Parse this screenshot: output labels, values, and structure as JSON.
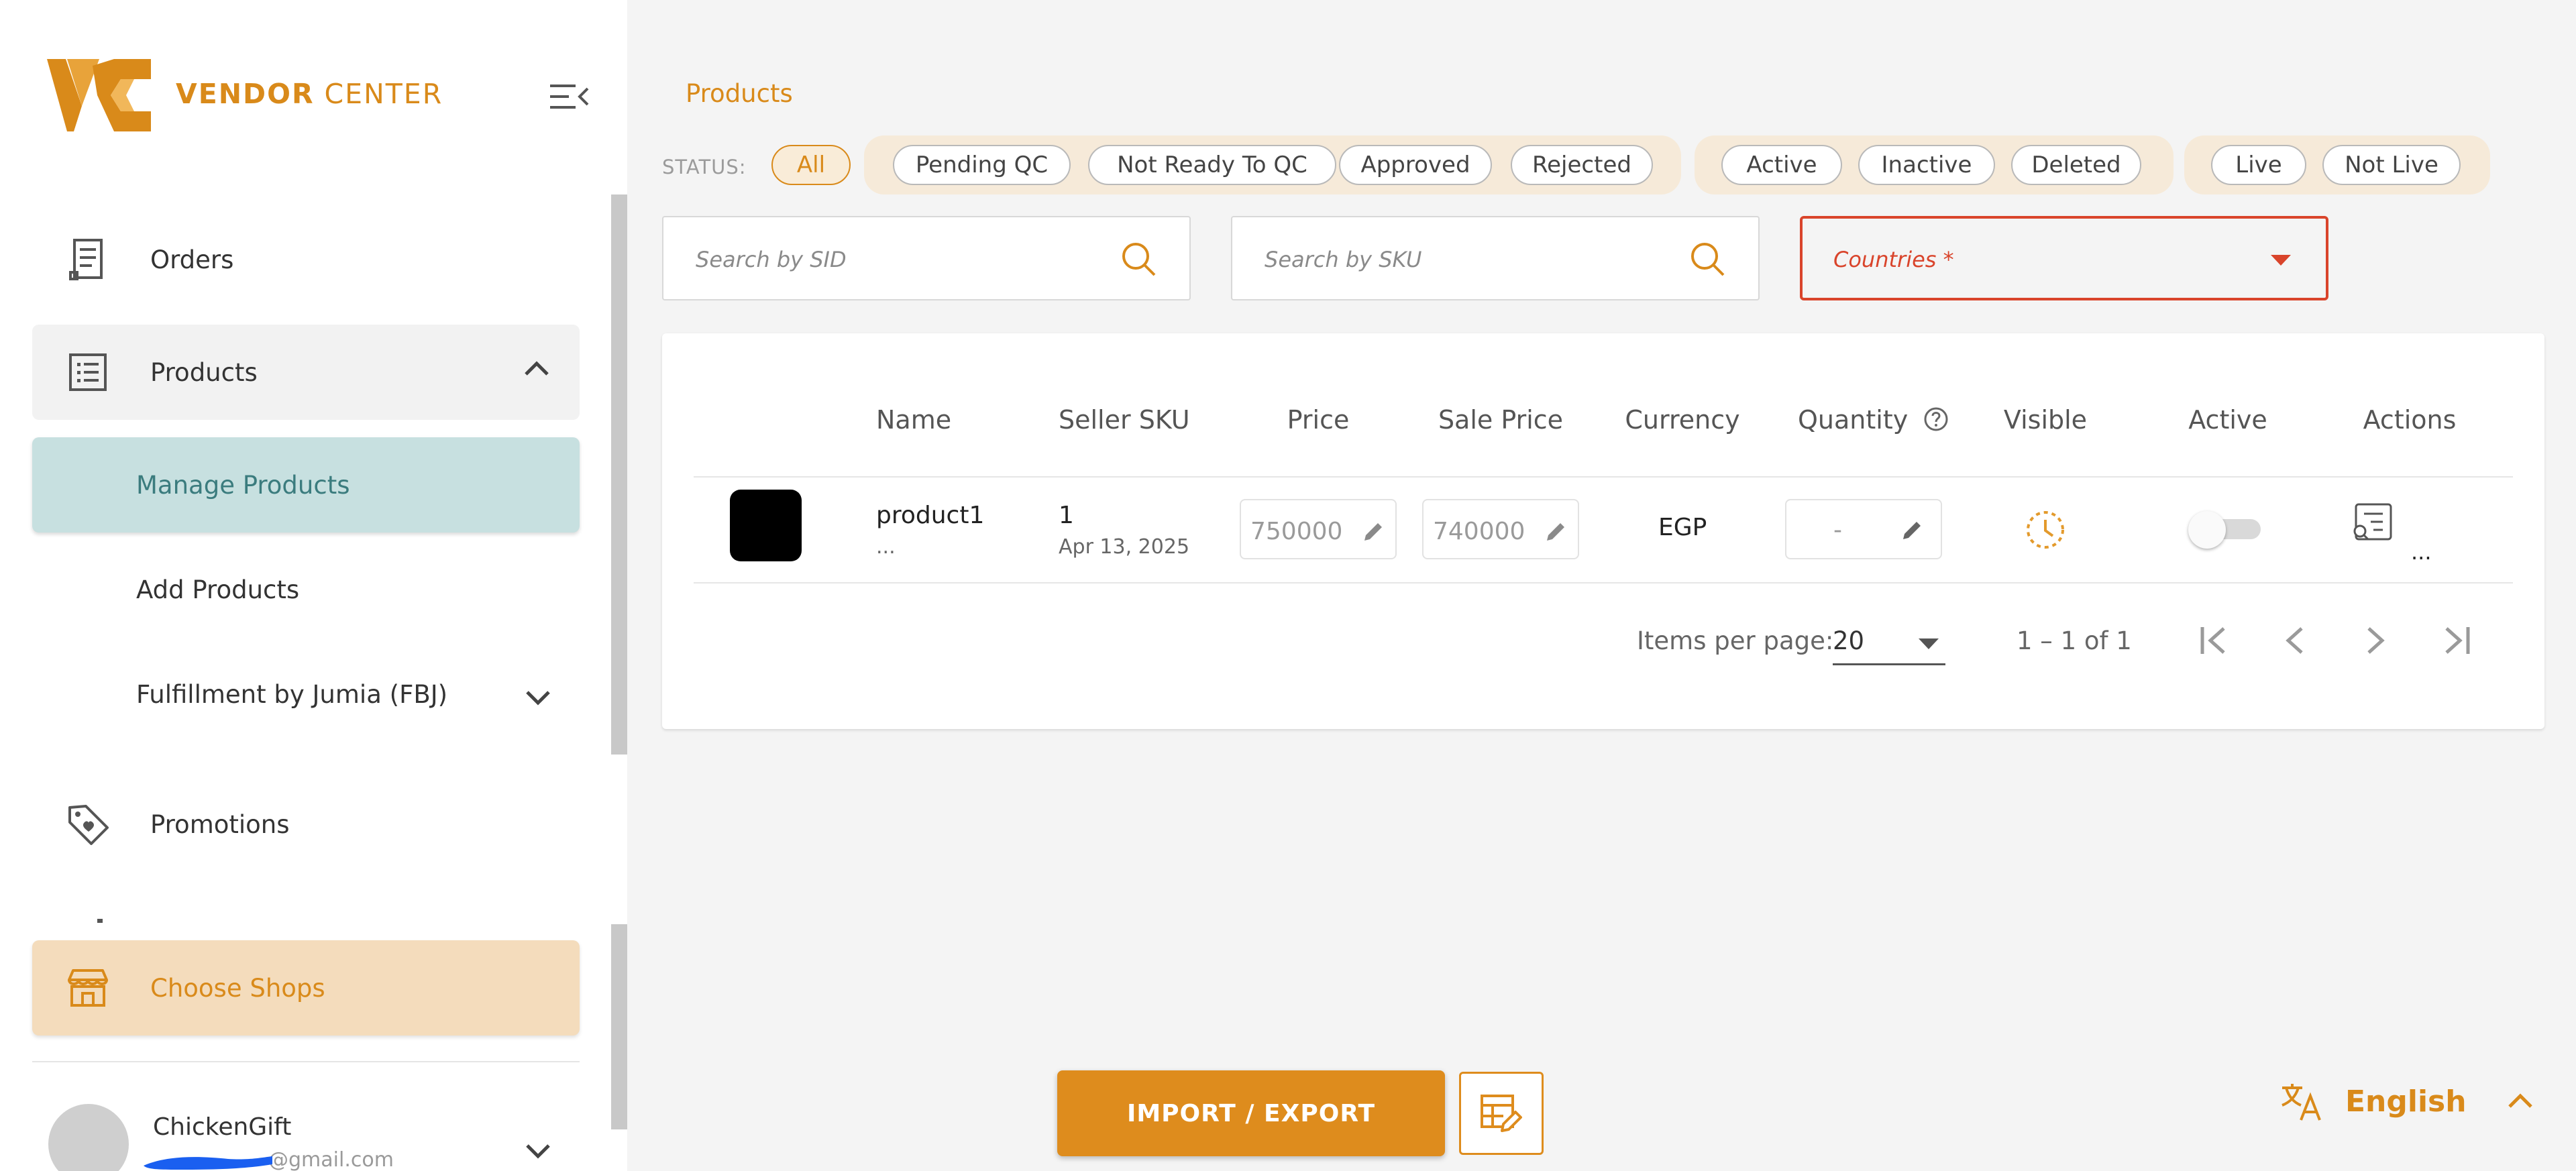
{
  "brand": {
    "name_bold": "VENDOR",
    "name_rest": " CENTER",
    "accent": "#d98a1a"
  },
  "sidebar": {
    "orders": "Orders",
    "products": "Products",
    "manage_products": "Manage Products",
    "add_products": "Add Products",
    "fbj": "Fulfillment by Jumia (FBJ)",
    "promotions": "Promotions",
    "choose_shops": "Choose Shops",
    "user": {
      "name": "ChickenGift",
      "email": "@gmail.com"
    }
  },
  "main": {
    "title": "Products",
    "status_label": "STATUS:",
    "chips": {
      "all": "All",
      "pending_qc": "Pending QC",
      "not_ready": "Not Ready To QC",
      "approved": "Approved",
      "rejected": "Rejected",
      "active": "Active",
      "inactive": "Inactive",
      "deleted": "Deleted",
      "live": "Live",
      "not_live": "Not Live"
    },
    "search_sid_placeholder": "Search by SID",
    "search_sku_placeholder": "Search by SKU",
    "countries_placeholder": "Countries *"
  },
  "table": {
    "headers": {
      "name": "Name",
      "seller_sku": "Seller SKU",
      "price": "Price",
      "sale_price": "Sale Price",
      "currency": "Currency",
      "quantity": "Quantity",
      "visible": "Visible",
      "active": "Active",
      "actions": "Actions"
    },
    "rows": [
      {
        "name": "product1",
        "name_more": "...",
        "seller_sku": "1",
        "date": "Apr 13, 2025",
        "price": "750000",
        "sale_price": "740000",
        "currency": "EGP",
        "quantity": "-",
        "actions_more": "..."
      }
    ]
  },
  "pagination": {
    "label": "Items per page:",
    "per_page": "20",
    "range": "1 – 1 of 1"
  },
  "footer": {
    "import_export": "IMPORT / EXPORT",
    "language": "English"
  }
}
